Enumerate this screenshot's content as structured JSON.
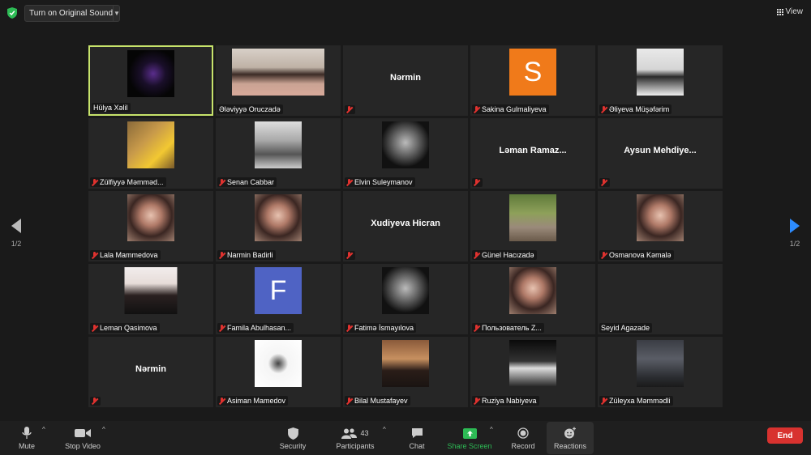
{
  "topbar": {
    "original_sound_label": "Turn on Original Sound",
    "view_label": "View"
  },
  "tiles": [
    {
      "name": "Hülya Xəlil",
      "muted": false,
      "active": true,
      "video": "dark-logo"
    },
    {
      "name": "Ələviyyə Oruczadə",
      "muted": false,
      "video": "person-photo"
    },
    {
      "name": "",
      "big": "Nərmin",
      "muted": true
    },
    {
      "name": "Sakina Gulmaliyeva",
      "muted": true,
      "letter": "S",
      "letter_bg": "#f07a1a"
    },
    {
      "name": "Əliyeva Müşəfərim",
      "muted": true,
      "video": "room-photo"
    },
    {
      "name": "Zülfiyyə Məmməd...",
      "muted": true,
      "video": "flowers-photo"
    },
    {
      "name": "Senan Cabbar",
      "muted": true,
      "video": "building-photo"
    },
    {
      "name": "Elvin Suleymanov",
      "muted": true,
      "video": "bw-portrait"
    },
    {
      "name": "",
      "big": "Ləman Ramaz...",
      "muted": true
    },
    {
      "name": "",
      "big": "Aysun Mehdiye...",
      "muted": true
    },
    {
      "name": "Lala Mammedova",
      "muted": true,
      "video": "girl-portrait"
    },
    {
      "name": "Narmin Badirli",
      "muted": true,
      "video": "girl-portrait"
    },
    {
      "name": "",
      "big": "Xudiyeva Hicran",
      "muted": true
    },
    {
      "name": "Günel Hacızadə",
      "muted": true,
      "video": "park-photo"
    },
    {
      "name": "Osmanova Kəmalə",
      "muted": true,
      "video": "girl-portrait"
    },
    {
      "name": "Leman Qasimova",
      "muted": true,
      "video": "mask-photo"
    },
    {
      "name": "Famila Abulhasan...",
      "muted": true,
      "letter": "F",
      "letter_bg": "#4f63c4"
    },
    {
      "name": "Fatimə İsmayılova",
      "muted": true,
      "video": "bw-portrait"
    },
    {
      "name": "Пользователь Z...",
      "muted": true,
      "video": "girl-portrait"
    },
    {
      "name": "Seyid Agazade",
      "muted": false,
      "video": "none"
    },
    {
      "name": "",
      "big": "Nərmin",
      "muted": true
    },
    {
      "name": "Asiman Mamedov",
      "muted": true,
      "video": "sketch-photo"
    },
    {
      "name": "Bilal Mustafayev",
      "muted": true,
      "video": "man-photo"
    },
    {
      "name": "Ruziya Nabiyeva",
      "muted": true,
      "video": "night-photo"
    },
    {
      "name": "Züleyxa Məmmədli",
      "muted": true,
      "video": "sky-photo"
    }
  ],
  "paging": {
    "left": "1/2",
    "right": "1/2"
  },
  "toolbar": {
    "mute": "Mute",
    "stop_video": "Stop Video",
    "security": "Security",
    "participants": "Participants",
    "participants_count": "43",
    "chat": "Chat",
    "share_screen": "Share Screen",
    "record": "Record",
    "reactions": "Reactions",
    "end": "End"
  },
  "colors": {
    "active_border": "#c7e36b",
    "share_green": "#2dbb55",
    "end_red": "#d8322f",
    "next_arrow_blue": "#2d8cff"
  }
}
